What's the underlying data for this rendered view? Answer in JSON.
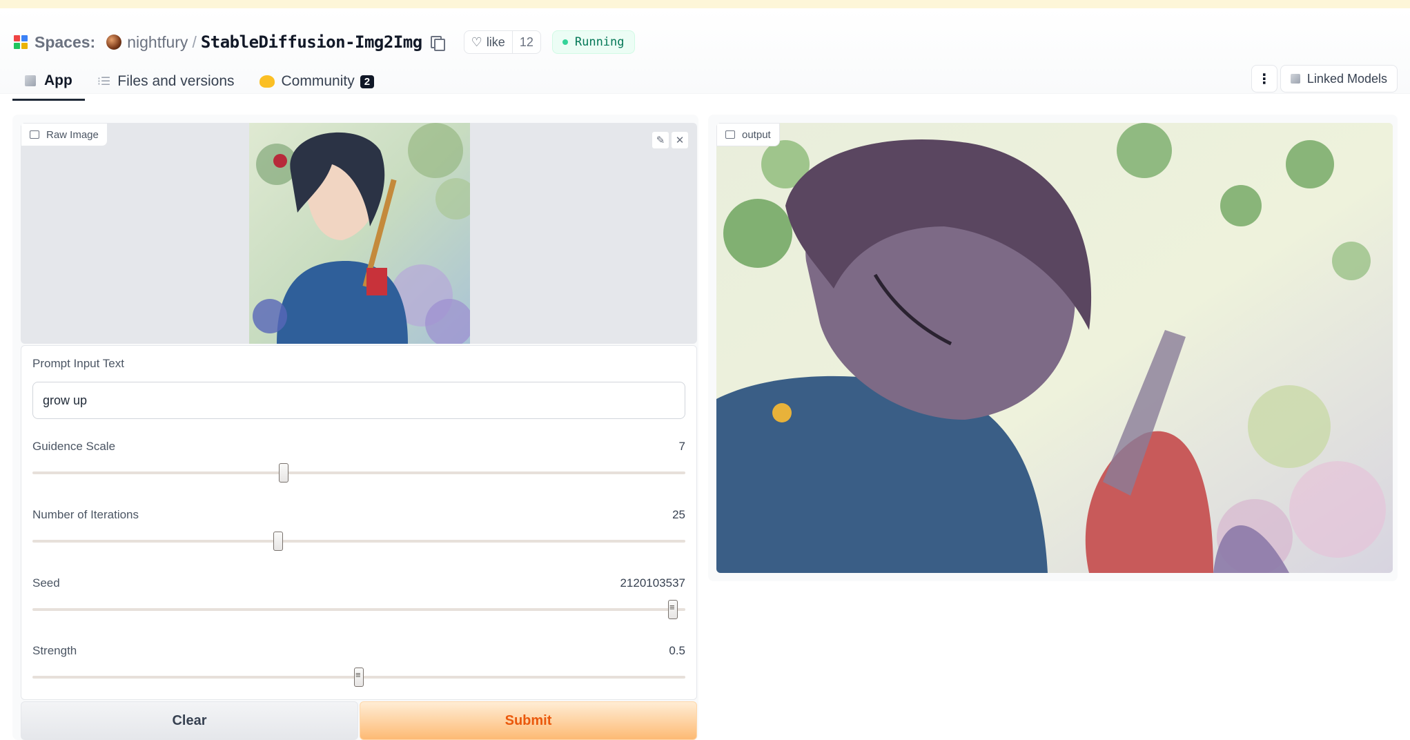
{
  "header": {
    "spaces_label": "Spaces:",
    "owner": "nightfury",
    "separator": "/",
    "repo": "StableDiffusion-Img2Img",
    "like_label": "like",
    "like_count": "12",
    "status": "Running"
  },
  "tabs": [
    {
      "label": "App",
      "icon": "app-cube-icon"
    },
    {
      "label": "Files and versions",
      "icon": "files-icon"
    },
    {
      "label": "Community",
      "icon": "community-icon",
      "badge": "2"
    }
  ],
  "toolbar": {
    "more_icon": "⋮",
    "linked_models_label": "Linked Models"
  },
  "raw_image": {
    "label": "Raw Image"
  },
  "form": {
    "prompt": {
      "label": "Prompt Input Text",
      "value": "grow up"
    },
    "guidance": {
      "label": "Guidence Scale",
      "value": "7",
      "fraction": 0.385
    },
    "iterations": {
      "label": "Number of Iterations",
      "value": "25",
      "fraction": 0.376
    },
    "seed": {
      "label": "Seed",
      "value": "2120103537",
      "fraction": 0.981
    },
    "strength": {
      "label": "Strength",
      "value": "0.5",
      "fraction": 0.5
    }
  },
  "buttons": {
    "clear": "Clear",
    "submit": "Submit"
  },
  "output": {
    "label": "output"
  },
  "colors": {
    "accent": "#f97316",
    "status_green": "#047857"
  }
}
